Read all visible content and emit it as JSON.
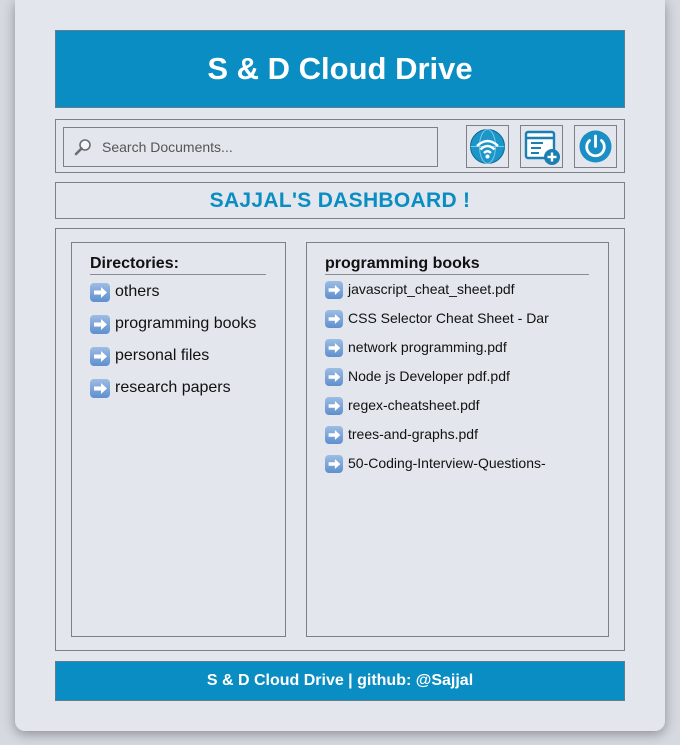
{
  "header": {
    "title": "S & D Cloud Drive"
  },
  "toolbar": {
    "search_placeholder": "Search Documents...",
    "search_icon": "magnifier-icon",
    "buttons": [
      {
        "name": "network-share-button",
        "icon": "wifi-globe-icon"
      },
      {
        "name": "add-file-button",
        "icon": "document-add-icon"
      },
      {
        "name": "logout-button",
        "icon": "power-icon"
      }
    ]
  },
  "dashboard": {
    "title": "SAJJAL'S DASHBOARD !"
  },
  "directories": {
    "heading": "Directories:",
    "items": [
      "others",
      "programming books",
      "personal files",
      "research papers"
    ]
  },
  "files": {
    "heading": "programming books",
    "items": [
      "javascript_cheat_sheet.pdf",
      "CSS Selector Cheat Sheet - Dar",
      "network programming.pdf",
      "Node js Developer pdf.pdf",
      "regex-cheatsheet.pdf",
      "trees-and-graphs.pdf",
      "50-Coding-Interview-Questions-"
    ]
  },
  "footer": {
    "text": "S & D Cloud Drive | github: @Sajjal"
  },
  "colors": {
    "accent": "#0a8dc2",
    "background": "#e3e6ec",
    "border": "#7d8087"
  }
}
